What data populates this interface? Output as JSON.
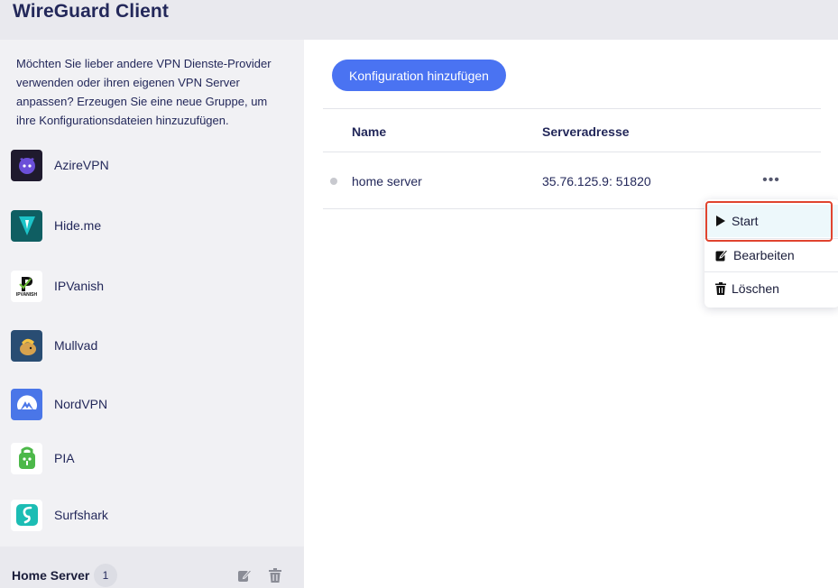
{
  "window": {
    "title": "WireGuard Client"
  },
  "sidebar": {
    "intro": "Möchten Sie lieber andere VPN Dienste-Provider verwenden oder ihren eigenen VPN Server anpassen? Erzeugen Sie eine neue Gruppe, um ihre Konfigurationsdateien hinzuzufügen.",
    "providers": [
      {
        "label": "AzireVPN",
        "icon": "azirevpn-logo-icon"
      },
      {
        "label": "Hide.me",
        "icon": "hideme-logo-icon"
      },
      {
        "label": "IPVanish",
        "icon": "ipvanish-logo-icon",
        "logo_text": "IPVANISH"
      },
      {
        "label": "Mullvad",
        "icon": "mullvad-logo-icon"
      },
      {
        "label": "NordVPN",
        "icon": "nordvpn-logo-icon"
      },
      {
        "label": "PIA",
        "icon": "pia-logo-icon"
      },
      {
        "label": "Surfshark",
        "icon": "surfshark-logo-icon"
      }
    ],
    "group": {
      "name": "Home Server",
      "count": "1"
    }
  },
  "main": {
    "add_button_label": "Konfiguration hinzufügen",
    "table": {
      "columns": [
        "Name",
        "Serveradresse"
      ],
      "rows": [
        {
          "name": "home server",
          "address": "35.76.125.9: 51820",
          "more": "•••"
        }
      ]
    },
    "context_menu": {
      "items": [
        {
          "label": "Start",
          "icon": "play-icon"
        },
        {
          "label": "Bearbeiten",
          "icon": "edit-icon"
        },
        {
          "label": "Löschen",
          "icon": "trash-icon"
        }
      ]
    }
  },
  "colors": {
    "accent": "#4a73f2",
    "title": "#23285a",
    "highlight": "#e0442f"
  }
}
